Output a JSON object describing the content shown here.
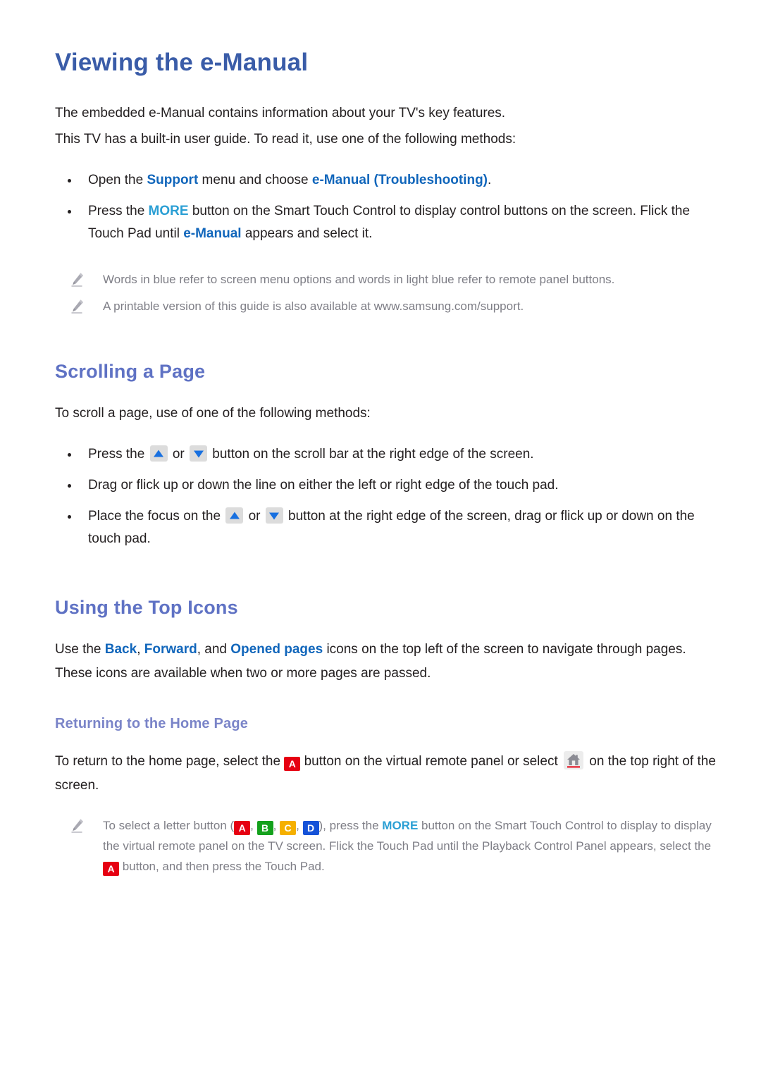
{
  "document": {
    "title": "Viewing the e-Manual",
    "intro": [
      "The embedded e-Manual contains information about your TV's key features.",
      "This TV has a built-in user guide. To read it, use one of the following methods:"
    ],
    "bullets": [
      {
        "parts": [
          {
            "t": "Open the ",
            "style": "plain"
          },
          {
            "t": "Support",
            "style": "menu-blue"
          },
          {
            "t": " menu and choose ",
            "style": "plain"
          },
          {
            "t": "e-Manual (Troubleshooting)",
            "style": "menu-blue"
          },
          {
            "t": ".",
            "style": "plain"
          }
        ]
      },
      {
        "parts": [
          {
            "t": "Press the ",
            "style": "plain"
          },
          {
            "t": "MORE",
            "style": "remote-blue"
          },
          {
            "t": " button on the Smart Touch Control to display control buttons on the screen. Flick the Touch Pad until ",
            "style": "plain"
          },
          {
            "t": "e-Manual",
            "style": "menu-blue"
          },
          {
            "t": " appears and select it.",
            "style": "plain"
          }
        ]
      }
    ],
    "notes": [
      {
        "icon": "pencil-icon",
        "text": "Words in blue refer to screen menu options and words in light blue refer to remote panel buttons."
      },
      {
        "icon": "pencil-icon",
        "text": "A printable version of this guide is also available at www.samsung.com/support."
      }
    ]
  },
  "scrolling": {
    "heading": "Scrolling a Page",
    "intro": "To scroll a page, use of one of the following methods:",
    "bullets": [
      {
        "id": "scroll-bullet-press",
        "parts": [
          {
            "t": "Press the ",
            "style": "plain"
          },
          {
            "t": "",
            "style": "arrow-up"
          },
          {
            "t": " or ",
            "style": "plain"
          },
          {
            "t": "",
            "style": "arrow-down"
          },
          {
            "t": " button on the scroll bar at the right edge of the screen.",
            "style": "plain"
          }
        ]
      },
      {
        "id": "scroll-bullet-drag",
        "parts": [
          {
            "t": "Drag or flick up or down the line on either the left or right edge of the touch pad.",
            "style": "plain"
          }
        ]
      },
      {
        "id": "scroll-bullet-focus",
        "parts": [
          {
            "t": "Place the focus on the ",
            "style": "plain"
          },
          {
            "t": "",
            "style": "arrow-up"
          },
          {
            "t": " or ",
            "style": "plain"
          },
          {
            "t": "",
            "style": "arrow-down"
          },
          {
            "t": " button at the right edge of the screen, drag or flick up or down on the touch pad.",
            "style": "plain"
          }
        ]
      }
    ]
  },
  "top_icons": {
    "heading": "Using the Top Icons",
    "paragraph_parts": [
      {
        "t": "Use the ",
        "style": "plain"
      },
      {
        "t": "Back",
        "style": "menu-blue"
      },
      {
        "t": ", ",
        "style": "plain"
      },
      {
        "t": "Forward",
        "style": "menu-blue"
      },
      {
        "t": ", and ",
        "style": "plain"
      },
      {
        "t": "Opened pages",
        "style": "menu-blue"
      },
      {
        "t": " icons on the top left of the screen to navigate through pages. These icons are available when two or more pages are passed.",
        "style": "plain"
      }
    ]
  },
  "home_page": {
    "heading": "Returning to the Home Page",
    "paragraph_parts": [
      {
        "t": "To return to the home page, select the ",
        "style": "plain"
      },
      {
        "t": "A",
        "style": "key-a"
      },
      {
        "t": " button on the virtual remote panel or select ",
        "style": "plain"
      },
      {
        "t": "",
        "style": "home-icon"
      },
      {
        "t": " on the top right of the screen.",
        "style": "plain"
      }
    ],
    "note_parts": [
      {
        "t": "To select a letter button (",
        "style": "plain"
      },
      {
        "t": "A",
        "style": "key-a"
      },
      {
        "t": ", ",
        "style": "plain"
      },
      {
        "t": "B",
        "style": "key-b"
      },
      {
        "t": ", ",
        "style": "plain"
      },
      {
        "t": "C",
        "style": "key-c"
      },
      {
        "t": ", ",
        "style": "plain"
      },
      {
        "t": "D",
        "style": "key-d"
      },
      {
        "t": "), press the ",
        "style": "plain"
      },
      {
        "t": "MORE",
        "style": "remote-blue"
      },
      {
        "t": " button on the Smart Touch Control to display to display the virtual remote panel on the TV screen. Flick the Touch Pad until the Playback Control Panel appears, select the ",
        "style": "plain"
      },
      {
        "t": "A",
        "style": "key-a"
      },
      {
        "t": " button, and then press the Touch Pad.",
        "style": "plain"
      }
    ]
  },
  "colors": {
    "h1_blue": "#3a5ca8",
    "h2_blue": "#5f72c4",
    "h3_blue": "#7a84c8",
    "menu_blue": "#1166bb",
    "remote_blue": "#2b9fd4",
    "key_a_red": "#e60012",
    "key_b_green": "#14a11c",
    "key_c_yellow": "#f5b000",
    "key_d_blue": "#1552d8",
    "body_text": "#231f20",
    "note_text": "#7e7e86"
  }
}
